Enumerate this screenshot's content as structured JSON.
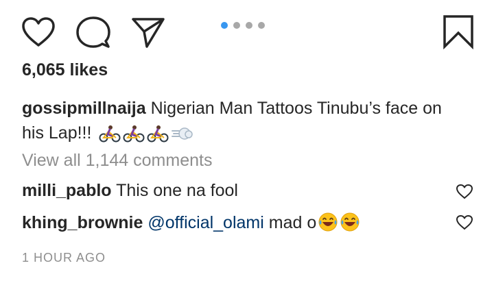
{
  "actions": {
    "like_icon": "heart-icon",
    "comment_icon": "comment-icon",
    "share_icon": "paper-plane-icon",
    "save_icon": "bookmark-icon"
  },
  "carousel": {
    "count": 4,
    "active": 1
  },
  "likes_text": "6,065 likes",
  "caption": {
    "username": "gossipmillnaija",
    "text": "Nigerian Man Tattoos Tinubu’s face on his Lap!!!",
    "emoji": [
      "person-biking-icon",
      "person-biking-icon",
      "person-biking-icon",
      "dashing-away-icon"
    ]
  },
  "view_all_comments": "View all 1,144 comments",
  "comments": [
    {
      "username": "milli_pablo",
      "text": "This one na fool",
      "mention": "",
      "emoji": []
    },
    {
      "username": "khing_brownie",
      "text": "mad o",
      "mention": "@official_olami",
      "emoji": [
        "laughing-tears-icon",
        "laughing-tears-icon"
      ]
    }
  ],
  "timestamp": "1 HOUR AGO",
  "colors": {
    "text": "#262626",
    "muted": "#8e8e8e",
    "accent": "#3897f0",
    "mention": "#003569"
  }
}
